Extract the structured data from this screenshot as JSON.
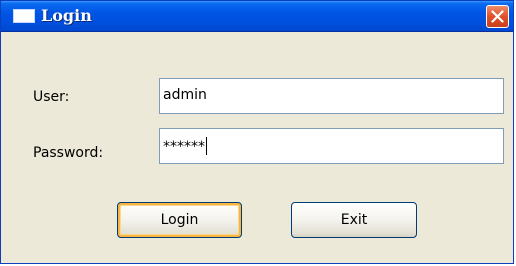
{
  "window": {
    "title": "Login"
  },
  "form": {
    "user_label": "User:",
    "user_value": "admin",
    "password_label": "Password:",
    "password_value": "******"
  },
  "buttons": {
    "login_label": "Login",
    "exit_label": "Exit"
  },
  "icons": {
    "title": "window-icon",
    "close": "close-icon"
  },
  "colors": {
    "titlebar": "#0055e5",
    "close_button": "#e0502a",
    "window_bg": "#ece9d8",
    "default_button_highlight": "#f8b544"
  }
}
